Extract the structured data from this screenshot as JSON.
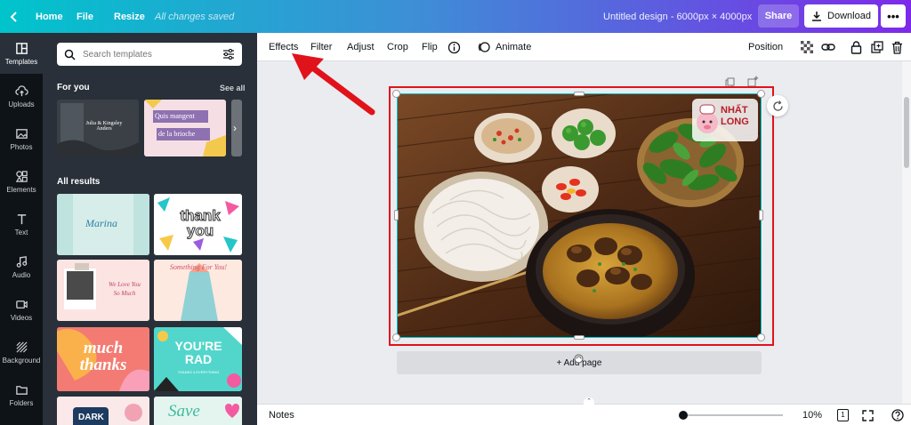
{
  "topbar": {
    "home": "Home",
    "file": "File",
    "resize": "Resize",
    "saved_status": "All changes saved",
    "design_title": "Untitled design - 6000px × 4000px",
    "share": "Share",
    "download": "Download",
    "more": "•••"
  },
  "rail": [
    {
      "label": "Templates",
      "icon": "templates-icon"
    },
    {
      "label": "Uploads",
      "icon": "upload-icon"
    },
    {
      "label": "Photos",
      "icon": "photos-icon"
    },
    {
      "label": "Elements",
      "icon": "elements-icon"
    },
    {
      "label": "Text",
      "icon": "text-icon"
    },
    {
      "label": "Audio",
      "icon": "music-icon"
    },
    {
      "label": "Videos",
      "icon": "video-icon"
    },
    {
      "label": "Background",
      "icon": "background-icon"
    },
    {
      "label": "Folders",
      "icon": "folder-icon"
    }
  ],
  "panel": {
    "search_placeholder": "Search templates",
    "for_you": "For you",
    "see_all": "See all",
    "all_results": "All results",
    "thumbs": {
      "t1": "Julia & Kingsley\nAnders",
      "t2a": "Quis mangent",
      "t2b": "de la brioche",
      "r1": "Marina",
      "r2": "thank you",
      "r3a": "We Love You",
      "r3b": "So Much",
      "r4": "Something For You!",
      "r5": "much thanks",
      "r6a": "YOU'RE",
      "r6b": "RAD",
      "r6c": "THANKS 4 EVERYTHING",
      "r7": "DARK",
      "r8": "Save"
    }
  },
  "toolbar": {
    "effects": "Effects",
    "filter": "Filter",
    "adjust": "Adjust",
    "crop": "Crop",
    "flip": "Flip",
    "animate": "Animate",
    "position": "Position"
  },
  "canvas": {
    "logo_line1": "NHẤT",
    "logo_line2": "LONG",
    "add_page": "+ Add page"
  },
  "bottombar": {
    "notes": "Notes",
    "zoom_value": 10,
    "zoom_label": "10%",
    "page_count": "1"
  },
  "colors": {
    "accent": "#7d2ae8",
    "gradient_start": "#00c4cc",
    "highlight_red": "#e0131a",
    "panel_bg": "#293039",
    "rail_bg": "#0e1318"
  }
}
